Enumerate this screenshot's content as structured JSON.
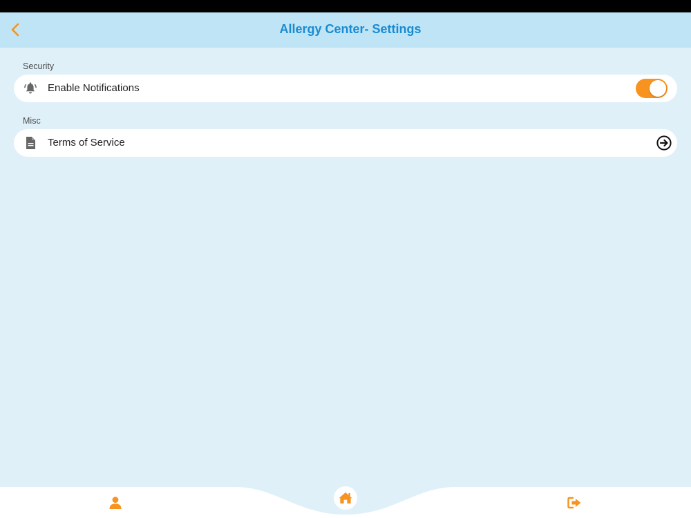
{
  "header": {
    "title": "Allergy Center- Settings",
    "back_icon": "chevron-left-icon"
  },
  "sections": [
    {
      "label": "Security",
      "items": [
        {
          "label": "Enable Notifications",
          "icon": "bell-icon",
          "control": "toggle",
          "enabled": true
        }
      ]
    },
    {
      "label": "Misc",
      "items": [
        {
          "label": "Terms of Service",
          "icon": "document-icon",
          "control": "arrow-right-circle-icon"
        }
      ]
    }
  ],
  "tab_bar": {
    "items": [
      {
        "name": "profile",
        "icon": "user-icon"
      },
      {
        "name": "home",
        "icon": "home-icon"
      },
      {
        "name": "logout",
        "icon": "sign-out-icon"
      }
    ]
  },
  "colors": {
    "accent": "#f7931e",
    "title": "#1a8bd1",
    "header_background": "#bfe4f6",
    "page_background": "#dff0f9",
    "row_background": "#ffffff"
  }
}
